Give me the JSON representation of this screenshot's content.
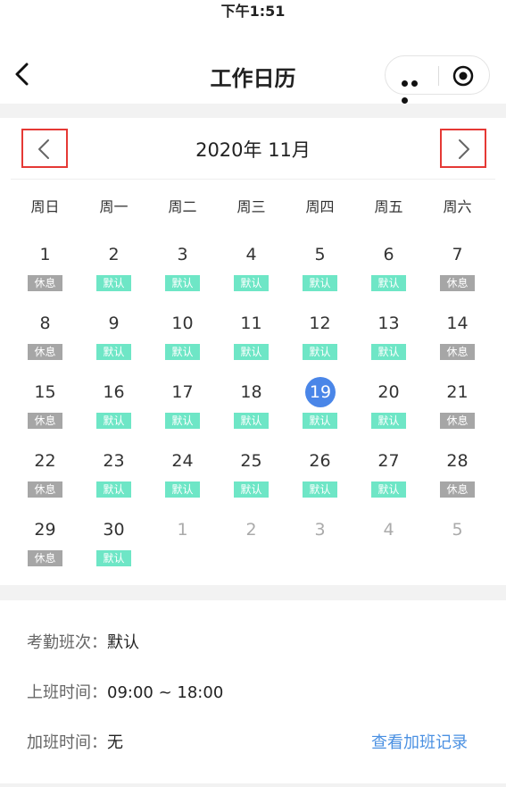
{
  "status_bar": {
    "time": "下午1:51"
  },
  "nav": {
    "title": "工作日历"
  },
  "calendar": {
    "month_title": "2020年 11月",
    "weekdays": [
      "周日",
      "周一",
      "周二",
      "周三",
      "周四",
      "周五",
      "周六"
    ],
    "days": [
      {
        "day": "1",
        "tag": "休息",
        "type": "rest"
      },
      {
        "day": "2",
        "tag": "默认",
        "type": "work"
      },
      {
        "day": "3",
        "tag": "默认",
        "type": "work"
      },
      {
        "day": "4",
        "tag": "默认",
        "type": "work"
      },
      {
        "day": "5",
        "tag": "默认",
        "type": "work"
      },
      {
        "day": "6",
        "tag": "默认",
        "type": "work"
      },
      {
        "day": "7",
        "tag": "休息",
        "type": "rest"
      },
      {
        "day": "8",
        "tag": "休息",
        "type": "rest"
      },
      {
        "day": "9",
        "tag": "默认",
        "type": "work"
      },
      {
        "day": "10",
        "tag": "默认",
        "type": "work"
      },
      {
        "day": "11",
        "tag": "默认",
        "type": "work"
      },
      {
        "day": "12",
        "tag": "默认",
        "type": "work"
      },
      {
        "day": "13",
        "tag": "默认",
        "type": "work"
      },
      {
        "day": "14",
        "tag": "休息",
        "type": "rest"
      },
      {
        "day": "15",
        "tag": "休息",
        "type": "rest"
      },
      {
        "day": "16",
        "tag": "默认",
        "type": "work"
      },
      {
        "day": "17",
        "tag": "默认",
        "type": "work"
      },
      {
        "day": "18",
        "tag": "默认",
        "type": "work"
      },
      {
        "day": "19",
        "tag": "默认",
        "type": "work",
        "today": true
      },
      {
        "day": "20",
        "tag": "默认",
        "type": "work"
      },
      {
        "day": "21",
        "tag": "休息",
        "type": "rest"
      },
      {
        "day": "22",
        "tag": "休息",
        "type": "rest"
      },
      {
        "day": "23",
        "tag": "默认",
        "type": "work"
      },
      {
        "day": "24",
        "tag": "默认",
        "type": "work"
      },
      {
        "day": "25",
        "tag": "默认",
        "type": "work"
      },
      {
        "day": "26",
        "tag": "默认",
        "type": "work"
      },
      {
        "day": "27",
        "tag": "默认",
        "type": "work"
      },
      {
        "day": "28",
        "tag": "休息",
        "type": "rest"
      },
      {
        "day": "29",
        "tag": "休息",
        "type": "rest"
      },
      {
        "day": "30",
        "tag": "默认",
        "type": "work"
      },
      {
        "day": "1",
        "tag": "",
        "type": "other"
      },
      {
        "day": "2",
        "tag": "",
        "type": "other"
      },
      {
        "day": "3",
        "tag": "",
        "type": "other"
      },
      {
        "day": "4",
        "tag": "",
        "type": "other"
      },
      {
        "day": "5",
        "tag": "",
        "type": "other"
      }
    ]
  },
  "info": {
    "shift_label": "考勤班次：",
    "shift_value": "默认",
    "work_time_label": "上班时间：",
    "work_time_value": "09:00 ~ 18:00",
    "overtime_label": "加班时间：",
    "overtime_value": "无",
    "overtime_link": "查看加班记录"
  },
  "colors": {
    "today": "#4a86e8",
    "work_tag": "#6ee6c6",
    "rest_tag": "#a6a6a6",
    "link": "#4a90e2",
    "highlight_box": "#e53935"
  }
}
